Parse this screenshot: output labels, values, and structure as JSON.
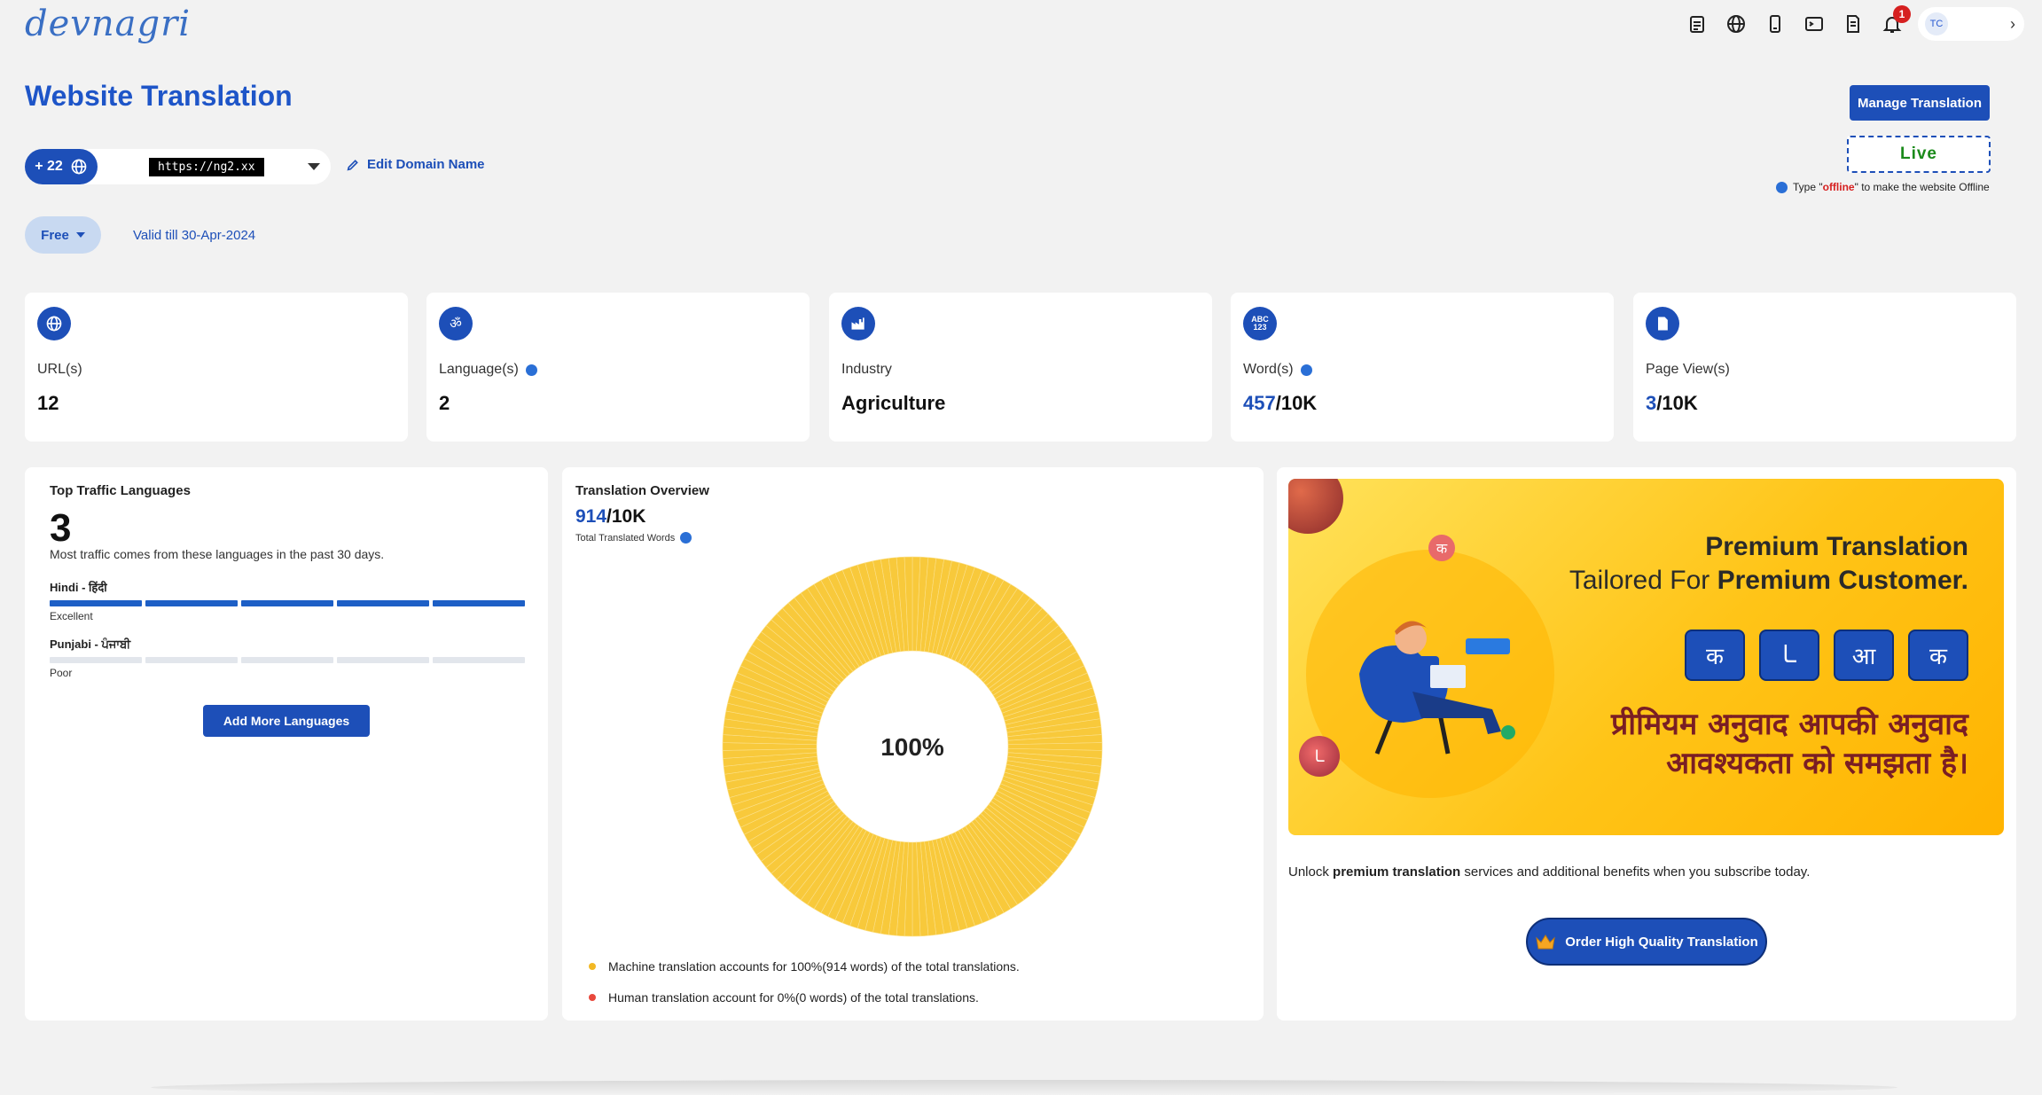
{
  "brand": {
    "logo_text": "devnagri"
  },
  "topbar": {
    "icons": [
      "clipboard-icon",
      "globe-icon",
      "phone-icon",
      "terminal-icon",
      "document-icon",
      "bell-icon"
    ],
    "notification_count": "1",
    "user_initials": "TC"
  },
  "page": {
    "title": "Website Translation"
  },
  "actions": {
    "manage_label": "Manage Translation",
    "live_label": "Live",
    "offline_hint_pre": "Type \"",
    "offline_hint_kw": "offline",
    "offline_hint_post": "\" to make the website Offline"
  },
  "domain": {
    "lang_count": "+ 22",
    "value": "https://ng2.xx",
    "edit_label": "Edit Domain Name"
  },
  "plan": {
    "name": "Free",
    "valid_text": "Valid till 30-Apr-2024"
  },
  "stats": [
    {
      "label": "URL(s)",
      "value": "12",
      "value_hl": "",
      "icon": "globe-icon"
    },
    {
      "label": "Language(s)",
      "value": "2",
      "value_hl": "",
      "icon": "translate-icon"
    },
    {
      "label": "Industry",
      "value": "Agriculture",
      "value_hl": "",
      "icon": "factory-icon"
    },
    {
      "label": "Word(s)",
      "value": "/10K",
      "value_hl": "457",
      "icon": "abc-icon"
    },
    {
      "label": "Page View(s)",
      "value": "/10K",
      "value_hl": "3",
      "icon": "page-icon"
    }
  ],
  "traffic": {
    "title": "Top Traffic Languages",
    "count": "3",
    "subtitle": "Most traffic comes from these languages in the past 30 days.",
    "languages": [
      {
        "name": "Hindi - हिंदी",
        "quality": "Excellent",
        "filled": 5
      },
      {
        "name": "Punjabi - ਪੰਜਾਬੀ",
        "quality": "Poor",
        "filled": 0
      }
    ],
    "add_label": "Add More Languages"
  },
  "overview": {
    "title": "Translation Overview",
    "total_hl": "914",
    "total_rest": "/10K",
    "sub_label": "Total Translated Words",
    "center_label": "100%",
    "legend": [
      {
        "text": "Machine translation accounts for 100%(914 words) of the total translations.",
        "color": "#f2b824"
      },
      {
        "text": "Human translation account for 0%(0 words) of the total translations.",
        "color": "#e8483c"
      }
    ]
  },
  "chart_data": {
    "type": "pie",
    "title": "Translation Overview",
    "categories": [
      "Machine translation",
      "Human translation"
    ],
    "values": [
      914,
      0
    ],
    "colors": [
      "#f8c93b",
      "#e8483c"
    ]
  },
  "promo": {
    "banner_title1": "Premium Translation",
    "banner_title2_pre": "Tailored  For ",
    "banner_title2_bold": "Premium Customer.",
    "tiles": [
      "क",
      "ـا",
      "आ",
      "क"
    ],
    "banner_hindi_line1": "प्रीमियम अनुवाद आपकी अनुवाद",
    "banner_hindi_line2": "आवश्यकता को समझता है।",
    "text_pre": "Unlock ",
    "text_bold": "premium translation",
    "text_post": " services and additional benefits when you subscribe today.",
    "order_label": "Order High Quality Translation"
  },
  "colors": {
    "primary": "#1d4fb8",
    "live": "#1a8a1a",
    "accent_yellow": "#f8c93b"
  }
}
